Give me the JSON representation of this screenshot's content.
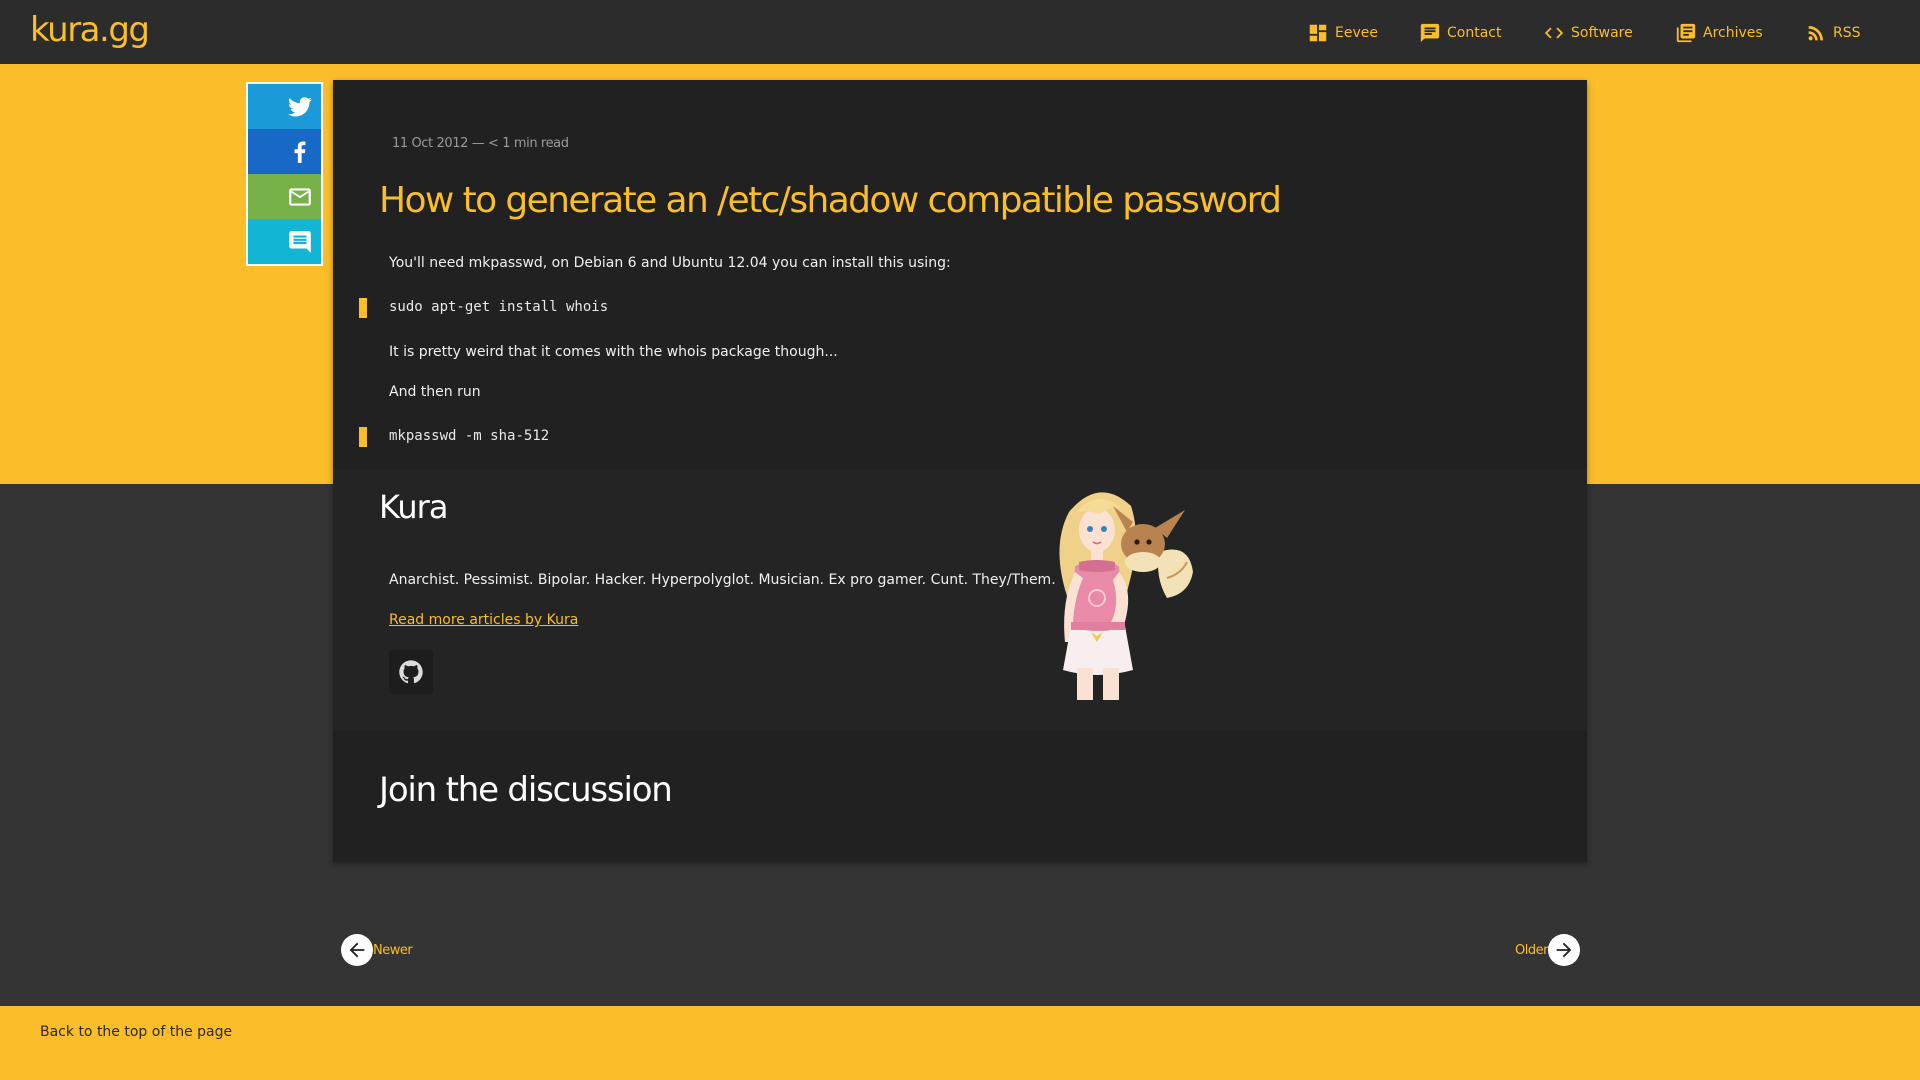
{
  "site": {
    "logo": "kura.gg"
  },
  "nav": {
    "items": [
      {
        "label": "Eevee",
        "icon": "dashboard-icon"
      },
      {
        "label": "Contact",
        "icon": "chat-icon"
      },
      {
        "label": "Software",
        "icon": "code-icon"
      },
      {
        "label": "Archives",
        "icon": "library-icon"
      },
      {
        "label": "RSS",
        "icon": "rss-icon"
      }
    ]
  },
  "share": {
    "buttons": [
      {
        "name": "twitter",
        "icon": "twitter-icon",
        "color": "#1a9ad6"
      },
      {
        "name": "facebook",
        "icon": "facebook-icon",
        "color": "#1868c5"
      },
      {
        "name": "email",
        "icon": "mail-icon",
        "color": "#78b04a"
      },
      {
        "name": "comment",
        "icon": "comment-icon",
        "color": "#12b6d4"
      }
    ]
  },
  "post": {
    "meta": "11 Oct 2012 — < 1 min read",
    "title": "How to generate an /etc/shadow compatible password",
    "paragraphs": [
      "You'll need mkpasswd, on Debian 6 and Ubuntu 12.04 you can install this using:",
      "It is pretty weird that it comes with the whois package though...",
      "And then run"
    ],
    "code": [
      "sudo apt-get install whois",
      "mkpasswd -m sha-512"
    ]
  },
  "author": {
    "name": "Kura",
    "bio": "Anarchist. Pessimist. Bipolar. Hacker. Hyperpolyglot. Musician. Ex pro gamer. Cunt. They/Them.",
    "link": "Read more articles by Kura",
    "social_icon": "github-icon"
  },
  "discussion": {
    "title": "Join the discussion"
  },
  "pager": {
    "newer": "Newer",
    "older": "Older"
  },
  "footer": {
    "back_to_top": "Back to the top of the page"
  },
  "colors": {
    "accent": "#fbbd2a",
    "header_bg": "#2c2c2c",
    "card_bg": "#212121",
    "page_bg": "#343434"
  }
}
